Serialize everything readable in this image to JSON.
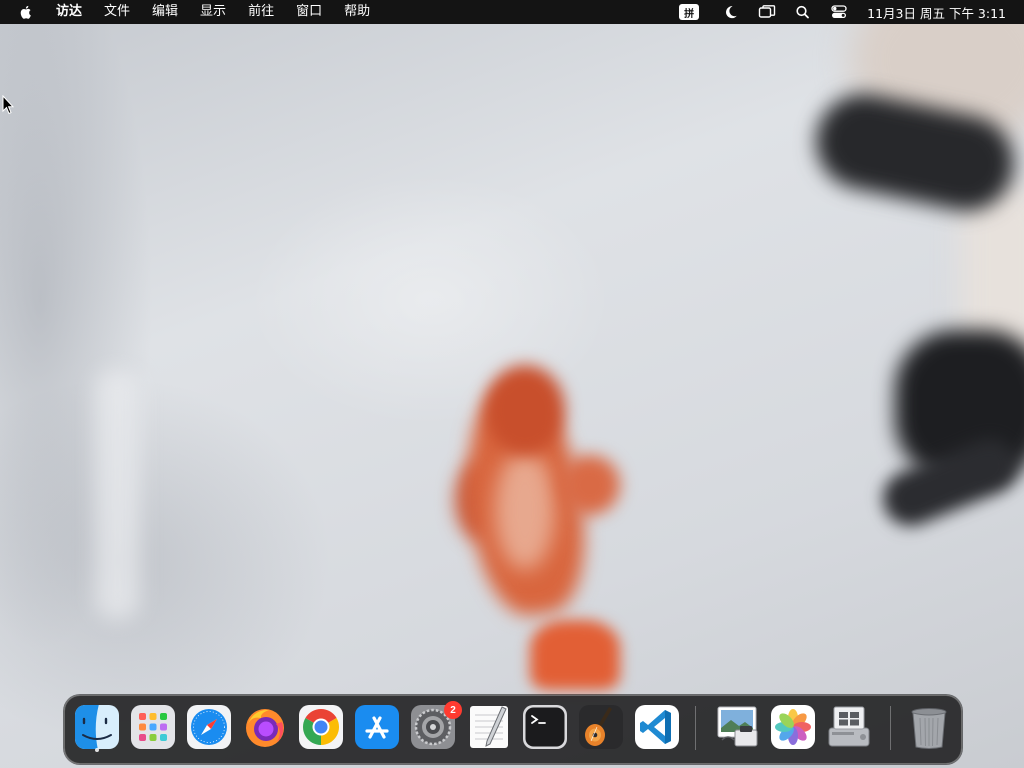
{
  "menubar": {
    "app_name": "访达",
    "menus": [
      "文件",
      "编辑",
      "显示",
      "前往",
      "窗口",
      "帮助"
    ],
    "input_method": "拼",
    "clock": "11月3日 周五  下午 3:11",
    "status_icons": [
      "moon-icon",
      "screen-mirroring-icon",
      "spotlight-search-icon",
      "control-center-icon"
    ]
  },
  "dock": {
    "apps": [
      {
        "name": "Finder",
        "icon": "finder-icon",
        "running": true
      },
      {
        "name": "Launchpad",
        "icon": "launchpad-icon"
      },
      {
        "name": "Safari",
        "icon": "safari-icon"
      },
      {
        "name": "Firefox",
        "icon": "firefox-icon"
      },
      {
        "name": "Chrome",
        "icon": "chrome-icon"
      },
      {
        "name": "App Store",
        "icon": "app-store-icon"
      },
      {
        "name": "System Settings",
        "icon": "system-settings-icon",
        "badge": "2"
      },
      {
        "name": "TextEdit",
        "icon": "textedit-icon"
      },
      {
        "name": "Terminal",
        "icon": "terminal-icon"
      },
      {
        "name": "GarageBand",
        "icon": "garageband-icon"
      },
      {
        "name": "Visual Studio Code",
        "icon": "vscode-icon"
      },
      {
        "name": "Preview",
        "icon": "preview-icon"
      },
      {
        "name": "Photos",
        "icon": "photos-icon"
      },
      {
        "name": "Boot Camp Assistant",
        "icon": "bootcamp-icon"
      },
      {
        "name": "Trash",
        "icon": "trash-icon"
      }
    ]
  },
  "colors": {
    "menubar_bg": "#141414",
    "badge_red": "#ff3b30",
    "vscode_blue": "#1f8ad2",
    "appstore_blue": "#1a8cf0"
  }
}
